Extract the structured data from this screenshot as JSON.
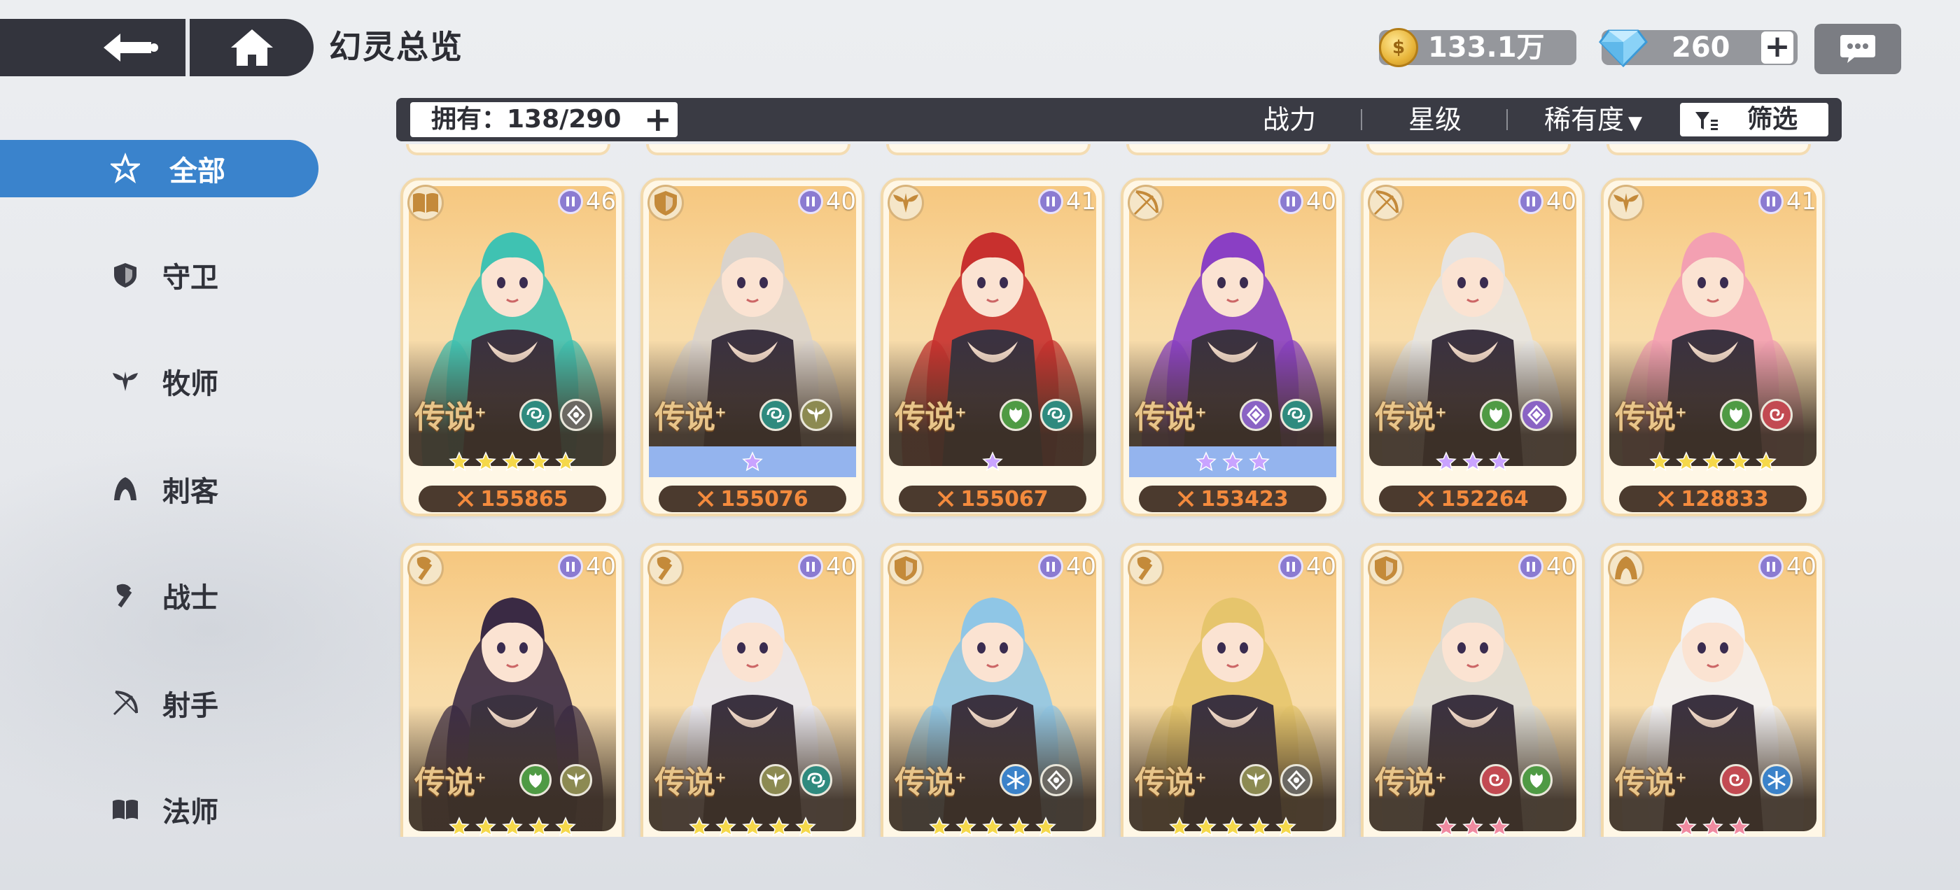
{
  "header": {
    "title": "幻灵总览"
  },
  "resources": {
    "gold": "133.1万",
    "gems": "260",
    "plus": "+"
  },
  "sidebar": {
    "items": [
      {
        "label": "全部",
        "icon": "all-star-icon",
        "active": true
      },
      {
        "label": "守卫",
        "icon": "shield-icon"
      },
      {
        "label": "牧师",
        "icon": "wings-icon"
      },
      {
        "label": "刺客",
        "icon": "hood-icon"
      },
      {
        "label": "战士",
        "icon": "axe-icon"
      },
      {
        "label": "射手",
        "icon": "bow-icon"
      },
      {
        "label": "法师",
        "icon": "book-icon"
      }
    ]
  },
  "filterbar": {
    "owned": "拥有：138/290",
    "sort_power": "战力",
    "sort_star": "星级",
    "sort_rarity": "稀有度",
    "filter": "筛选"
  },
  "colors": {
    "accent": "#3a83cc",
    "power_text": "#f38a3d",
    "star_gold": "#f5d84a",
    "star_purple": "#c9a3ff",
    "star_pink": "#f08aa0"
  },
  "cards": [
    {
      "class": "book",
      "level": "46",
      "rarity": "传说",
      "elements": [
        "wind",
        "neutral"
      ],
      "stars": 5,
      "star_color": "gold",
      "tinted": false,
      "power": "155865",
      "hair": "#3fc2b2"
    },
    {
      "class": "shield",
      "level": "40",
      "rarity": "传说",
      "elements": [
        "wind",
        "wings"
      ],
      "stars": 1,
      "star_color": "purple",
      "tinted": true,
      "power": "155076",
      "hair": "#d9d3cc"
    },
    {
      "class": "wings",
      "level": "41",
      "rarity": "传说",
      "elements": [
        "leaf",
        "wind"
      ],
      "stars": 1,
      "star_color": "purple",
      "tinted": false,
      "power": "155067",
      "hair": "#c8302e"
    },
    {
      "class": "bow",
      "level": "40",
      "rarity": "传说",
      "elements": [
        "diamond",
        "wind"
      ],
      "stars": 3,
      "star_color": "purple",
      "tinted": true,
      "power": "153423",
      "hair": "#8a3fc4"
    },
    {
      "class": "bow",
      "level": "40",
      "rarity": "传说",
      "elements": [
        "leaf",
        "diamond"
      ],
      "stars": 3,
      "star_color": "purple",
      "tinted": false,
      "power": "152264",
      "hair": "#e6e4e2"
    },
    {
      "class": "wings",
      "level": "41",
      "rarity": "传说",
      "elements": [
        "leaf",
        "spiral"
      ],
      "stars": 5,
      "star_color": "gold",
      "tinted": false,
      "power": "128833",
      "hair": "#f3a0b2"
    },
    {
      "class": "axe",
      "level": "40",
      "rarity": "传说",
      "elements": [
        "leaf",
        "wings"
      ],
      "stars": 5,
      "star_color": "gold",
      "tinted": false,
      "power": "",
      "hair": "#3a2a44"
    },
    {
      "class": "axe",
      "level": "40",
      "rarity": "传说",
      "elements": [
        "wings",
        "wind"
      ],
      "stars": 5,
      "star_color": "gold",
      "tinted": false,
      "power": "",
      "hair": "#e8e8f0"
    },
    {
      "class": "shield",
      "level": "40",
      "rarity": "传说",
      "elements": [
        "frost",
        "neutral"
      ],
      "stars": 5,
      "star_color": "gold",
      "tinted": false,
      "power": "",
      "hair": "#8fc6e6"
    },
    {
      "class": "axe",
      "level": "40",
      "rarity": "传说",
      "elements": [
        "wings",
        "neutral"
      ],
      "stars": 5,
      "star_color": "gold",
      "tinted": false,
      "power": "",
      "hair": "#e6c56c"
    },
    {
      "class": "shield",
      "level": "40",
      "rarity": "传说",
      "elements": [
        "spiral",
        "leaf"
      ],
      "stars": 3,
      "star_color": "pink",
      "tinted": false,
      "power": "",
      "hair": "#dcdcd6"
    },
    {
      "class": "hood",
      "level": "40",
      "rarity": "传说",
      "elements": [
        "spiral",
        "frost"
      ],
      "stars": 3,
      "star_color": "pink",
      "tinted": false,
      "power": "",
      "hair": "#f2f2f4"
    }
  ]
}
